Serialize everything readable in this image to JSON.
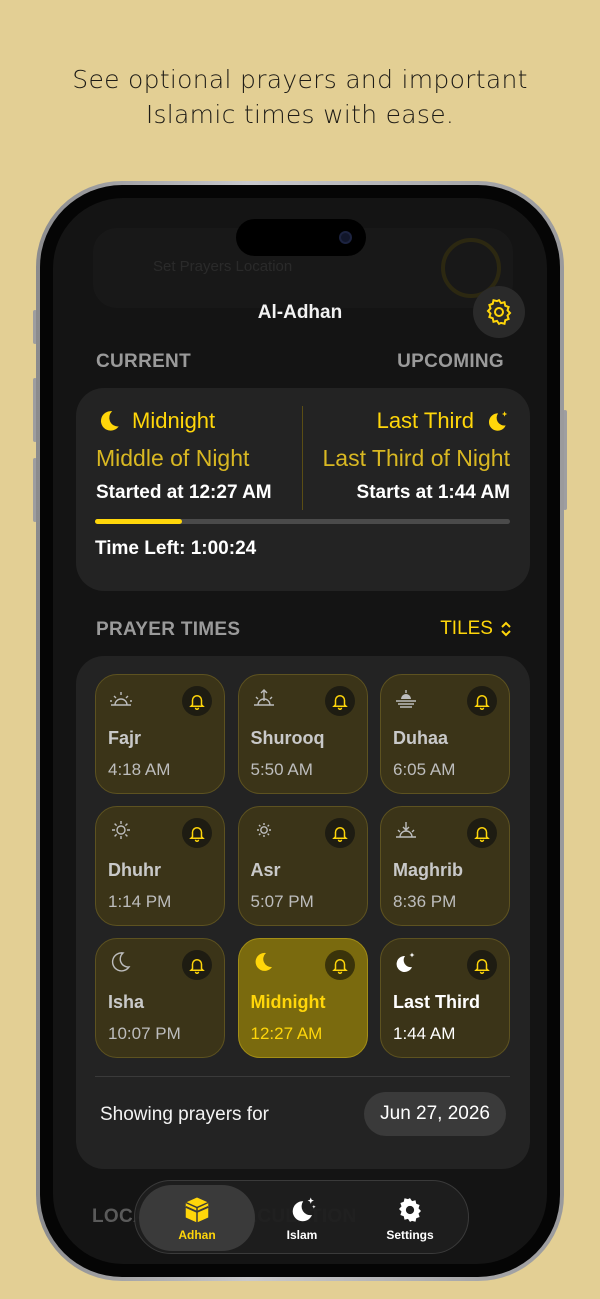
{
  "headline": {
    "line1": "See optional prayers and important",
    "line2": "Islamic times with ease."
  },
  "ghost_header": {
    "text": "Set Prayers Location"
  },
  "nav": {
    "title": "Al-Adhan",
    "settings_icon": "gear-icon"
  },
  "current": {
    "label": "CURRENT",
    "name": "Midnight",
    "subtitle": "Middle of Night",
    "time_text": "Started at 12:27 AM",
    "icon": "moon-icon"
  },
  "upcoming": {
    "label": "UPCOMING",
    "name": "Last Third",
    "subtitle": "Last Third of Night",
    "time_text": "Starts at 1:44 AM",
    "icon": "moon-stars-icon"
  },
  "progress": {
    "fraction": 0.21
  },
  "time_left": "Time Left: 1:00:24",
  "prayer_section": {
    "label": "PRAYER TIMES",
    "view_toggle": "TILES"
  },
  "prayers": [
    {
      "name": "Fajr",
      "time": "4:18 AM",
      "icon": "sunrise-icon"
    },
    {
      "name": "Shurooq",
      "time": "5:50 AM",
      "icon": "sun-up-icon"
    },
    {
      "name": "Duhaa",
      "time": "6:05 AM",
      "icon": "sun-haze-icon"
    },
    {
      "name": "Dhuhr",
      "time": "1:14 PM",
      "icon": "sun-icon"
    },
    {
      "name": "Asr",
      "time": "5:07 PM",
      "icon": "sun-small-icon"
    },
    {
      "name": "Maghrib",
      "time": "8:36 PM",
      "icon": "sunset-icon"
    },
    {
      "name": "Isha",
      "time": "10:07 PM",
      "icon": "moon-icon"
    },
    {
      "name": "Midnight",
      "time": "12:27 AM",
      "icon": "moon-icon"
    },
    {
      "name": "Last Third",
      "time": "1:44 AM",
      "icon": "moon-stars-icon"
    }
  ],
  "showing": {
    "label": "Showing prayers for",
    "date": "Jun 27, 2026"
  },
  "behind_section": {
    "label": "LOCATION & CALCULATION"
  },
  "tabs": [
    {
      "label": "Adhan",
      "icon": "kaaba-icon"
    },
    {
      "label": "Islam",
      "icon": "moon-stars-icon"
    },
    {
      "label": "Settings",
      "icon": "gear-icon"
    }
  ],
  "colors": {
    "accent": "#ffd60a",
    "background": "#e3cf94",
    "screen": "#141414",
    "card": "#232323"
  }
}
